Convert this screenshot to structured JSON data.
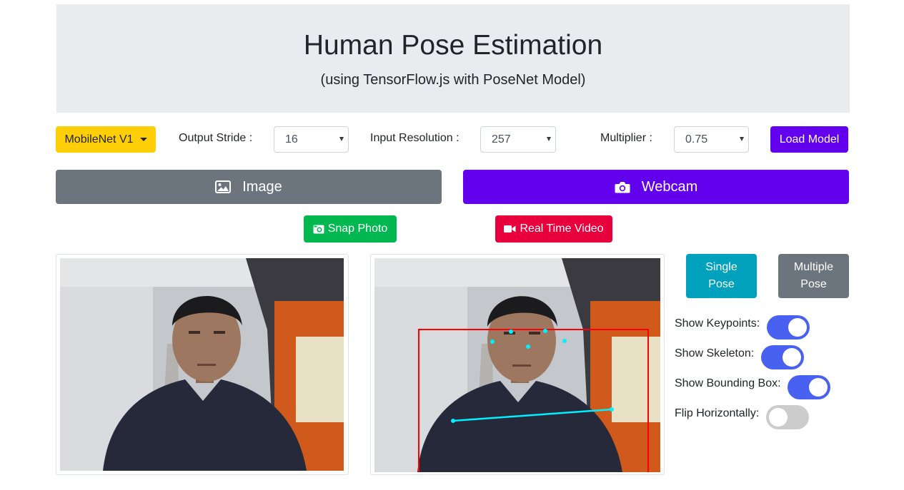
{
  "header": {
    "title": "Human Pose Estimation",
    "subtitle": "(using TensorFlow.js with PoseNet Model)"
  },
  "toolbar": {
    "model_dropdown_label": "MobileNet V1",
    "output_stride_label": "Output Stride :",
    "output_stride_value": "16",
    "input_resolution_label": "Input Resolution :",
    "input_resolution_value": "257",
    "multiplier_label": "Multiplier :",
    "multiplier_value": "0.75",
    "load_model_label": "Load Model"
  },
  "mode_tabs": {
    "image_label": "Image",
    "webcam_label": "Webcam"
  },
  "webcam_actions": {
    "snap_photo_label": "Snap Photo",
    "real_time_video_label": "Real Time Video"
  },
  "pose_mode": {
    "single_label": [
      "Single",
      "Pose"
    ],
    "multiple_label": [
      "Multiple",
      "Pose"
    ]
  },
  "options": [
    {
      "label": "Show Keypoints:",
      "on": true
    },
    {
      "label": "Show Skeleton:",
      "on": true
    },
    {
      "label": "Show Bounding Box:",
      "on": true
    },
    {
      "label": "Flip Horizontally:",
      "on": false
    }
  ],
  "colors": {
    "primary_purple": "#6200ee",
    "dropdown_yellow": "#fecf06",
    "snap_green": "#00b84f",
    "video_red": "#e7003b",
    "single_teal": "#00a1bd",
    "gray": "#6c757d",
    "toggle_on": "#4961f0",
    "toggle_off": "#cccccc",
    "keypoint_cyan": "#00f0ff",
    "bbox_red": "#ff0000"
  }
}
